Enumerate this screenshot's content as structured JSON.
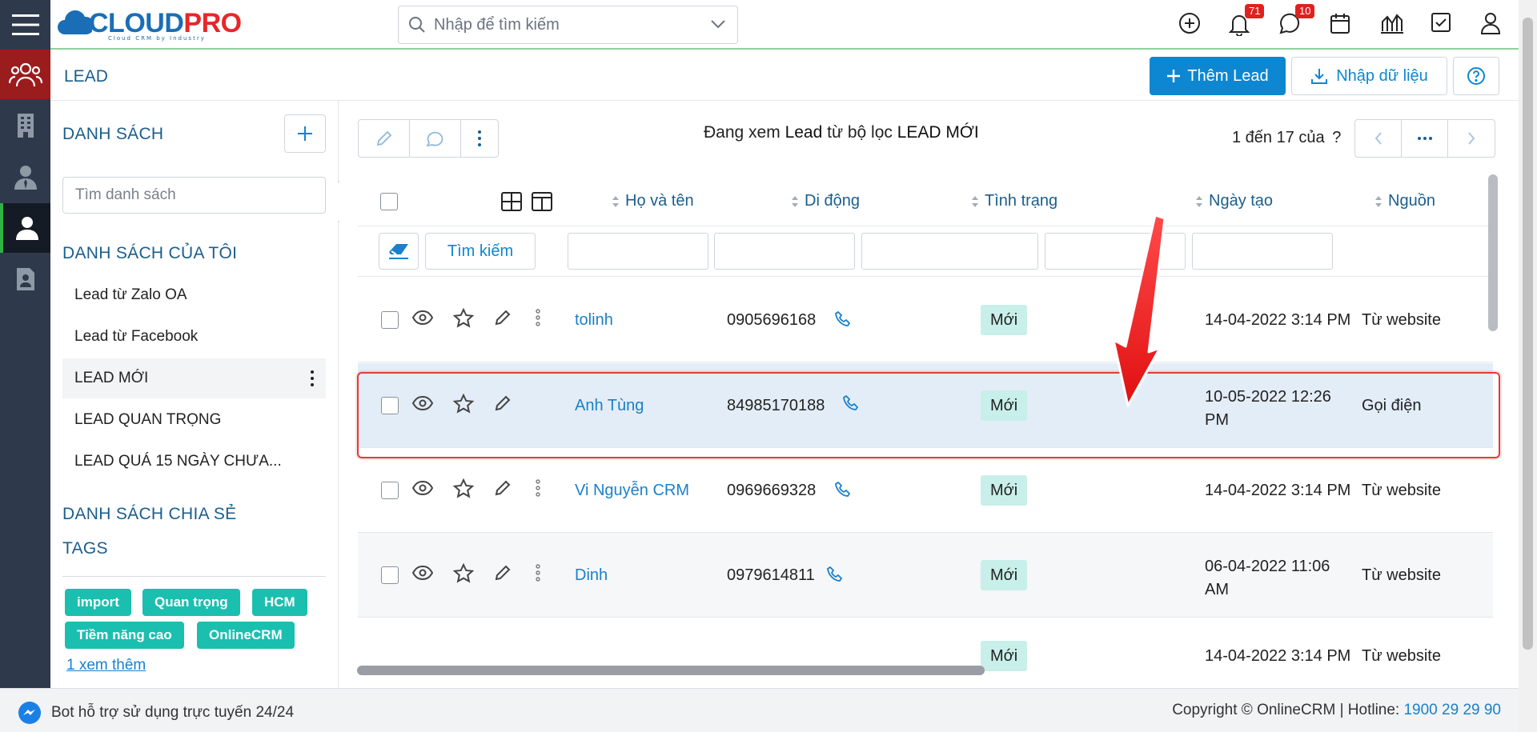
{
  "app": {
    "logo_part1": "CLOUD",
    "logo_part2": "PRO",
    "logo_tagline": "Cloud CRM by Industry"
  },
  "topbar": {
    "search_placeholder": "Nhập để tìm kiếm",
    "notifications_count": "71",
    "messages_count": "10"
  },
  "page": {
    "title": "LEAD",
    "add_button": "Thêm Lead",
    "import_button": "Nhập dữ liệu"
  },
  "sidebar": {
    "lists_title": "DANH SÁCH",
    "search_placeholder": "Tìm danh sách",
    "my_lists_title": "DANH SÁCH CỦA TÔI",
    "my_lists": [
      {
        "label": "Lead từ Zalo OA",
        "active": false
      },
      {
        "label": "Lead từ Facebook",
        "active": false
      },
      {
        "label": "LEAD MỚI",
        "active": true
      },
      {
        "label": "LEAD QUAN TRỌNG",
        "active": false
      },
      {
        "label": "LEAD QUÁ 15 NGÀY CHƯA...",
        "active": false
      }
    ],
    "shared_title": "DANH SÁCH CHIA SẺ",
    "tags_title": "TAGS",
    "tags": [
      "import",
      "Quan trọng",
      "HCM",
      "Tiềm năng cao",
      "OnlineCRM"
    ],
    "more_link": "1  xem thêm"
  },
  "toolbar": {
    "viewing_prefix": "Đang xem",
    "viewing_module": "Lead",
    "viewing_middle": "từ bộ lọc",
    "viewing_filter": "LEAD MỚI",
    "pager_text": "1 đến 17 của",
    "pager_unknown": "?"
  },
  "table": {
    "columns": [
      "Họ và tên",
      "Di động",
      "Tình trạng",
      "Ngày tạo",
      "Nguồn"
    ],
    "search_button": "Tìm kiếm",
    "rows": [
      {
        "name": "tolinh",
        "phone": "0905696168",
        "status": "Mới",
        "created": "14-04-2022 3:14 PM",
        "source": "Từ website"
      },
      {
        "name": "Anh Tùng",
        "phone": "84985170188",
        "status": "Mới",
        "created": "10-05-2022 12:26 PM",
        "source": "Gọi điện"
      },
      {
        "name": "Vi Nguyễn CRM",
        "phone": "0969669328",
        "status": "Mới",
        "created": "14-04-2022 3:14 PM",
        "source": "Từ website"
      },
      {
        "name": "Dinh",
        "phone": "0979614811",
        "status": "Mới",
        "created": "06-04-2022 11:06 AM",
        "source": "Từ website"
      },
      {
        "name": "",
        "phone": "",
        "status": "Mới",
        "created": "14-04-2022 3:14 PM",
        "source": "Từ website"
      }
    ]
  },
  "footer": {
    "bot_text": "Bot hỗ trợ sử dụng trực tuyến 24/24",
    "copyright": "Copyright © OnlineCRM",
    "hotline_label": "Hotline:",
    "hotline_number": "1900 29 29 90"
  },
  "colors": {
    "brand_blue": "#0d87d1",
    "title_blue": "#1b5e8c",
    "tag_teal": "#1bbfb0",
    "status_bg": "#c8efe9",
    "highlight_red": "#e53a3a"
  }
}
